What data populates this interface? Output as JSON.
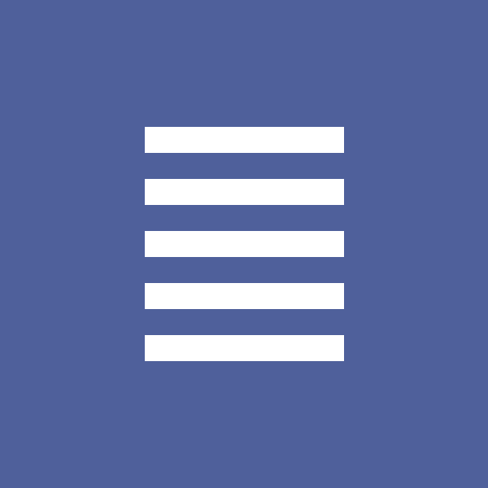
{
  "screen": {
    "background_color": "#4f609b",
    "foreground_color": "#ffffff",
    "icon": "hamburger-menu-icon"
  }
}
